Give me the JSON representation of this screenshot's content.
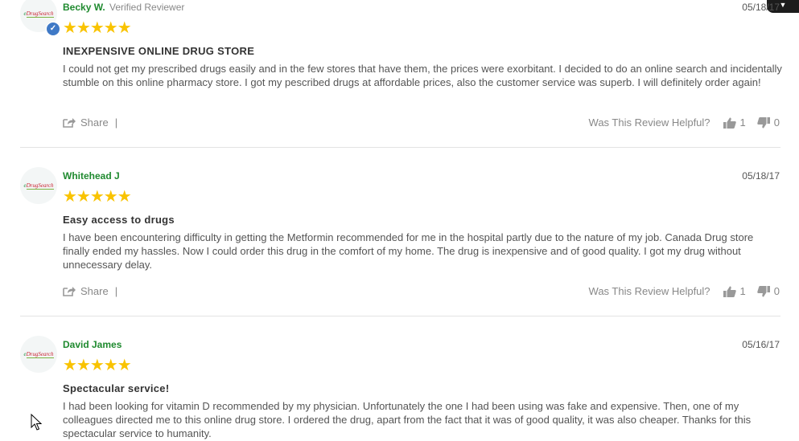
{
  "brand": {
    "logo_prefix": "e",
    "logo_suffix": "DrugSearch",
    "star_color": "#f9c300",
    "name_color": "#1f8a2f",
    "verified_color": "#3f79c6"
  },
  "reviews": [
    {
      "name": "Becky W.",
      "badge": "Verified Reviewer",
      "date": "05/18/17",
      "rating": 5,
      "stars": "★★★★★",
      "title": "INEXPENSIVE ONLINE DRUG STORE",
      "body": "I could not get my prescribed drugs easily and in the few stores that have them, the prices were exorbitant. I decided to do an online search and incidentally stumble on this online pharmacy store. I got my pescribed drugs at affordable prices, also the customer service was superb. I will definitely order again!",
      "share_label": "Share",
      "helpful_label": "Was This Review Helpful?",
      "up_count": "1",
      "down_count": "0"
    },
    {
      "name": "Whitehead J",
      "date": "05/18/17",
      "rating": 5,
      "stars": "★★★★★",
      "title": "Easy access to drugs",
      "body": "I have been encountering difficulty in getting the Metformin recommended for me in the hospital partly due to the nature of my job. Canada Drug store finally ended my hassles. Now I could order this drug in the comfort of my home. The drug is inexpensive and of good quality. I got my drug without unnecessary delay.",
      "share_label": "Share",
      "helpful_label": "Was This Review Helpful?",
      "up_count": "1",
      "down_count": "0"
    },
    {
      "name": "David James",
      "date": "05/16/17",
      "rating": 5,
      "stars": "★★★★★",
      "title": "Spectacular service!",
      "body": "I had been looking for vitamin D recommended by my physician. Unfortunately the one I had been using was fake and expensive. Then, one of my colleagues directed me to this online drug store. I ordered the drug, apart from the fact that it was of good quality, it was also cheaper. Thanks for this spectacular service to humanity."
    }
  ]
}
